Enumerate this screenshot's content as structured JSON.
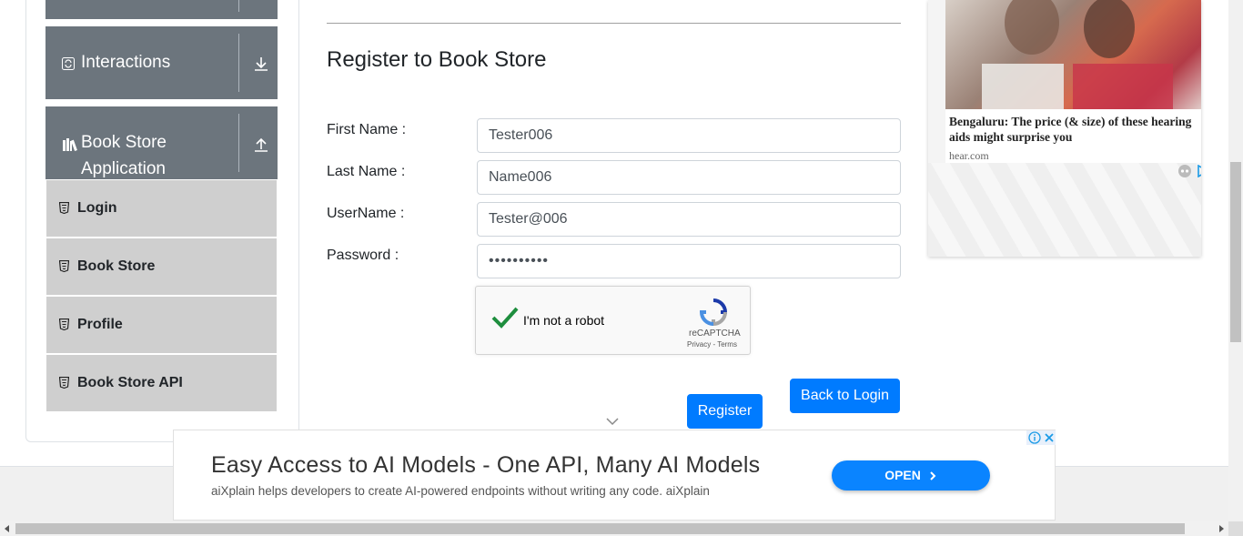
{
  "sidebar": {
    "groups": [
      {
        "label": "Interactions",
        "icon": "refresh-icon",
        "toggle_icon": "download-arrow-icon"
      },
      {
        "label": "Book Store Application",
        "label_line1": "Book Store",
        "label_line2": "Application",
        "icon": "books-icon",
        "toggle_icon": "upload-arrow-icon"
      }
    ],
    "items": [
      {
        "label": "Login",
        "icon": "html5-icon"
      },
      {
        "label": "Book Store",
        "icon": "html5-icon"
      },
      {
        "label": "Profile",
        "icon": "html5-icon"
      },
      {
        "label": "Book Store API",
        "icon": "html5-icon"
      }
    ]
  },
  "form": {
    "title": "Register to Book Store",
    "fields": [
      {
        "label": "First Name :",
        "value": "Tester006"
      },
      {
        "label": "Last Name :",
        "value": "Name006"
      },
      {
        "label": "UserName :",
        "value": "Tester@006"
      },
      {
        "label": "Password :",
        "value": "••••••••••"
      }
    ],
    "captcha": {
      "label": "I'm not a robot",
      "brand": "reCAPTCHA",
      "links": "Privacy - Terms",
      "checked": true
    },
    "register_label": "Register",
    "back_label": "Back to Login"
  },
  "ad_right": {
    "headline": "Bengaluru: The price (& size) of these hearing aids might surprise you",
    "source": "hear.com"
  },
  "ad_banner": {
    "title": "Easy Access to AI Models - One API, Many AI Models",
    "description": "aiXplain helps developers to create AI-powered endpoints without writing any code. aiXplain",
    "cta": "OPEN"
  },
  "colors": {
    "primary": "#007bff",
    "sidebar_group": "#6c757d",
    "sidebar_item": "#cfcfcf",
    "banner_cta": "#0a84ff"
  }
}
